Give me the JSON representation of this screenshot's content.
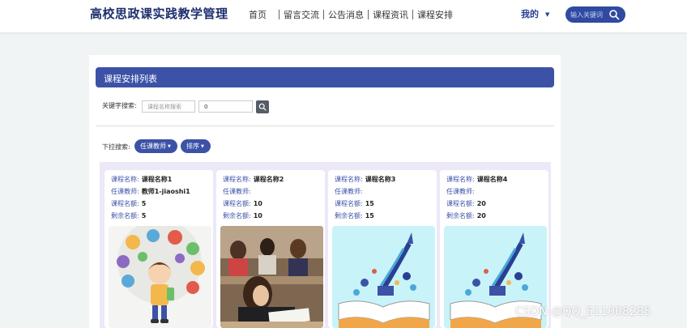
{
  "header": {
    "logo": "高校思政课实践教学管理",
    "nav": [
      "首页",
      "留言交流",
      "公告消息",
      "课程资讯",
      "课程安排"
    ],
    "user_label": "我的",
    "search_placeholder": "输入关键词"
  },
  "page": {
    "title": "课程安排列表",
    "keyword_label": "关键字搜索:",
    "keyword_placeholder": "课程名称搜索",
    "number_value": "0",
    "dropdown_label": "下拉搜索:",
    "teacher_filter": "任课教师",
    "sort_filter": "排序"
  },
  "labels": {
    "course_name": "课程名称:",
    "teacher": "任课教师:",
    "quota": "课程名额:",
    "remaining": "剩余名额:"
  },
  "courses": [
    {
      "name": "课程名称1",
      "teacher": "教师1-jiaoshi1",
      "quota": "5",
      "remaining": "5",
      "image_icon": "cartoon-boy-education-icons"
    },
    {
      "name": "课程名称2",
      "teacher": "",
      "quota": "10",
      "remaining": "10",
      "image_icon": "students-exam-classroom-photo"
    },
    {
      "name": "课程名称3",
      "teacher": "",
      "quota": "15",
      "remaining": "15",
      "image_icon": "book-rocket-win-illustration"
    },
    {
      "name": "课程名称4",
      "teacher": "",
      "quota": "20",
      "remaining": "20",
      "image_icon": "book-rocket-win-illustration"
    }
  ],
  "watermark": "CSDN @QQ_511008285",
  "colors": {
    "brand": "#3c52a6",
    "logo": "#1d2f6e",
    "grid_bg": "#ece8f8"
  }
}
